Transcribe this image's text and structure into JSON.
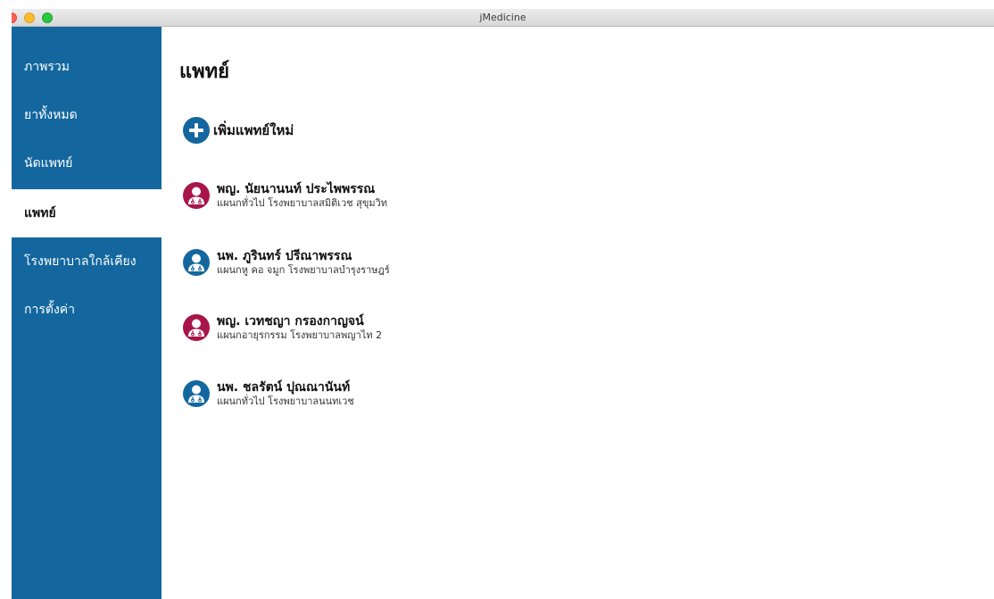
{
  "window": {
    "title": "jMedicine"
  },
  "sidebar": {
    "items": [
      {
        "label": "ภาพรวม",
        "active": false
      },
      {
        "label": "ยาทั้งหมด",
        "active": false
      },
      {
        "label": "นัดแพทย์",
        "active": false
      },
      {
        "label": "แพทย์",
        "active": true
      },
      {
        "label": "โรงพยาบาลใกล้เคียง",
        "active": false
      },
      {
        "label": "การตั้งค่า",
        "active": false
      }
    ]
  },
  "main": {
    "title": "แพทย์",
    "add_label": "เพิ่มแพทย์ใหม่",
    "doctors": [
      {
        "name": "พญ. นัยนานนท์ ประไพพรรณ",
        "detail": "แผนกทั่วไป โรงพยาบาลสมิติเวช สุขุมวิท",
        "avatar_color": "#a81548"
      },
      {
        "name": "นพ. ภูรินทร์ ปรีณาพรรณ",
        "detail": "แผนกหู คอ จมูก โรงพยาบาลบำรุงราษฎร์",
        "avatar_color": "#13679e"
      },
      {
        "name": "พญ. เวทชญา กรองกาญจน์",
        "detail": "แผนกอายุรกรรม โรงพยาบาลพญาไท 2",
        "avatar_color": "#a81548"
      },
      {
        "name": "นพ. ชลรัตน์ ปุณณานันท์",
        "detail": "แผนกทั่วไป โรงพยาบาลนนทเวช",
        "avatar_color": "#13679e"
      }
    ]
  },
  "colors": {
    "sidebar_bg": "#13679e",
    "accent": "#13679e",
    "female_doctor": "#a81548",
    "male_doctor": "#13679e"
  },
  "icons": {
    "add": "plus-circle-icon",
    "doctor": "doctor-avatar-icon"
  }
}
